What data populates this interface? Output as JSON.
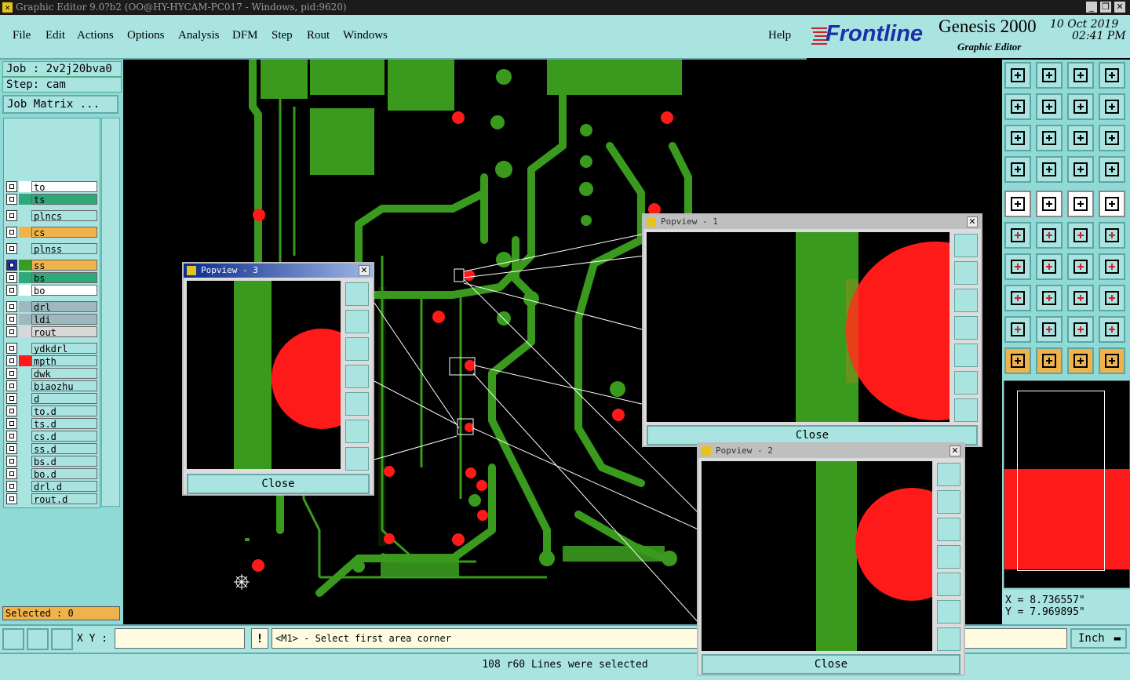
{
  "window": {
    "title": "Graphic Editor 9.0?b2 (OO@HY-HYCAM-PC017 - Windows, pid:9620)"
  },
  "menu": {
    "items": [
      "File",
      "Edit",
      "Actions",
      "Options",
      "Analysis",
      "DFM",
      "Step",
      "Rout",
      "Windows"
    ],
    "help": "Help"
  },
  "brand": {
    "logo": "Frontline",
    "product": "Genesis 2000",
    "subtitle": "Graphic Editor",
    "date": "10 Oct 2019",
    "time": "02:41 PM"
  },
  "job": {
    "job_label": "Job : 2v2j20bva0",
    "step_label": "Step: cam",
    "matrix_button": "Job Matrix ..."
  },
  "layers": [
    {
      "name": "to",
      "color": "#ffffff",
      "swatch": "#ffffff",
      "active": false
    },
    {
      "name": "ts",
      "color": "#2fa87a",
      "swatch": "#2fa87a",
      "active": false
    },
    {
      "name": "plncs",
      "color": "#a9e4e1",
      "swatch": "#a9e4e1",
      "active": false
    },
    {
      "name": "cs",
      "color": "#f0b24a",
      "swatch": "#f0b24a",
      "active": false
    },
    {
      "name": "plnss",
      "color": "#a9e4e1",
      "swatch": "#a9e4e1",
      "active": false
    },
    {
      "name": "ss",
      "color": "#f0b24a",
      "swatch": "#3a9a2a",
      "active": true
    },
    {
      "name": "bs",
      "color": "#2fa87a",
      "swatch": "#2fa87a",
      "active": false
    },
    {
      "name": "bo",
      "color": "#ffffff",
      "swatch": "#ffffff",
      "active": false
    },
    {
      "name": "drl",
      "color": "#9fb8c0",
      "swatch": "#9fb8c0",
      "active": false
    },
    {
      "name": "ldi",
      "color": "#9fb8c0",
      "swatch": "#9fb8c0",
      "active": false
    },
    {
      "name": "rout",
      "color": "#d8d8d8",
      "swatch": "#d8d8d8",
      "active": false
    },
    {
      "name": "ydkdrl",
      "color": "#a9e4e1",
      "swatch": "#a9e4e1",
      "active": false
    },
    {
      "name": "mpth",
      "color": "#a9e4e1",
      "swatch": "#ff1a1a",
      "active": false
    },
    {
      "name": "dwk",
      "color": "#a9e4e1",
      "swatch": "#a9e4e1",
      "active": false
    },
    {
      "name": "biaozhu",
      "color": "#a9e4e1",
      "swatch": "#a9e4e1",
      "active": false
    },
    {
      "name": "d",
      "color": "#a9e4e1",
      "swatch": "#a9e4e1",
      "active": false
    },
    {
      "name": "to.d",
      "color": "#a9e4e1",
      "swatch": "#a9e4e1",
      "active": false
    },
    {
      "name": "ts.d",
      "color": "#a9e4e1",
      "swatch": "#a9e4e1",
      "active": false
    },
    {
      "name": "cs.d",
      "color": "#a9e4e1",
      "swatch": "#a9e4e1",
      "active": false
    },
    {
      "name": "ss.d",
      "color": "#a9e4e1",
      "swatch": "#a9e4e1",
      "active": false
    },
    {
      "name": "bs.d",
      "color": "#a9e4e1",
      "swatch": "#a9e4e1",
      "active": false
    },
    {
      "name": "bo.d",
      "color": "#a9e4e1",
      "swatch": "#a9e4e1",
      "active": false
    },
    {
      "name": "drl.d",
      "color": "#a9e4e1",
      "swatch": "#a9e4e1",
      "active": false
    },
    {
      "name": "rout.d",
      "color": "#a9e4e1",
      "swatch": "#a9e4e1",
      "active": false
    }
  ],
  "selected": "Selected : 0",
  "coords": {
    "x": "X = 8.736557\"",
    "y": "Y = 7.969895\""
  },
  "xy_label": "X Y :",
  "prompt": "<M1> - Select first area corner",
  "status_message": "108 r60 Lines were selected",
  "units": "Inch",
  "popviews": [
    {
      "title": "Popview - 3",
      "close": "Close"
    },
    {
      "title": "Popview - 1",
      "close": "Close"
    },
    {
      "title": "Popview - 2",
      "close": "Close"
    }
  ],
  "colors": {
    "panel": "#a9e4e1",
    "trace": "#3a9a1e",
    "pad": "#ff1a1a",
    "highlight": "#f0b24a"
  }
}
